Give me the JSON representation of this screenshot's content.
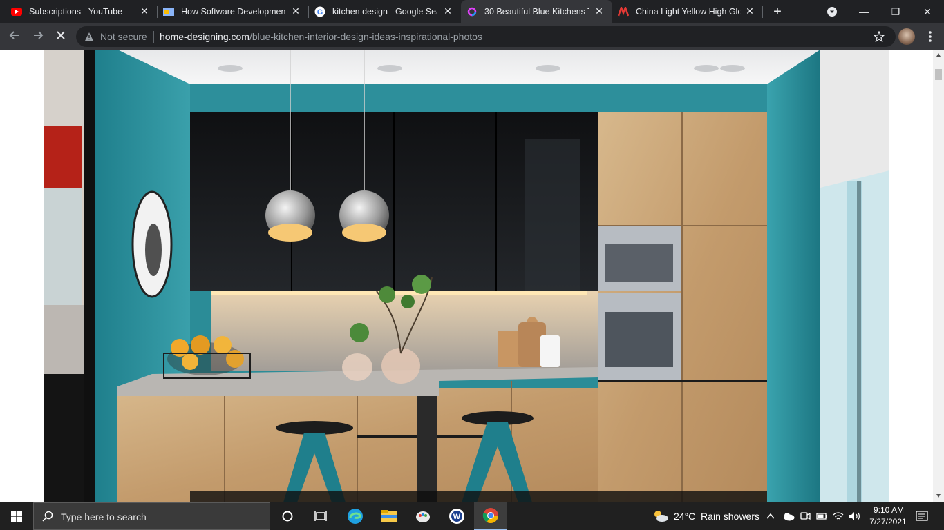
{
  "tabs": [
    {
      "title": "Subscriptions - YouTube",
      "icon": "youtube-icon"
    },
    {
      "title": "How Software Development",
      "icon": "site-icon"
    },
    {
      "title": "kitchen design - Google Sea",
      "icon": "google-icon"
    },
    {
      "title": "30 Beautiful Blue Kitchens To",
      "icon": "site-icon",
      "active": true
    },
    {
      "title": "China Light Yellow High Glo",
      "icon": "made-in-china-icon"
    }
  ],
  "tab_close": "✕",
  "new_tab": "+",
  "window": {
    "minimize": "—",
    "restore": "❐",
    "close": "✕"
  },
  "address": {
    "security": "Not secure",
    "domain": "home-designing.com",
    "path": "/blue-kitchen-interior-design-ideas-inspirational-photos"
  },
  "taskbar": {
    "search_placeholder": "Type here to search",
    "weather": "24°C  Rain showers",
    "time": "9:10 AM",
    "date": "7/27/2021"
  },
  "colors": {
    "wall_teal": "#2f8f9a",
    "cabinet_black": "#161719",
    "wood": "#c8a57a",
    "chrome_dark": "#202124",
    "chrome_tab": "#35363a"
  }
}
